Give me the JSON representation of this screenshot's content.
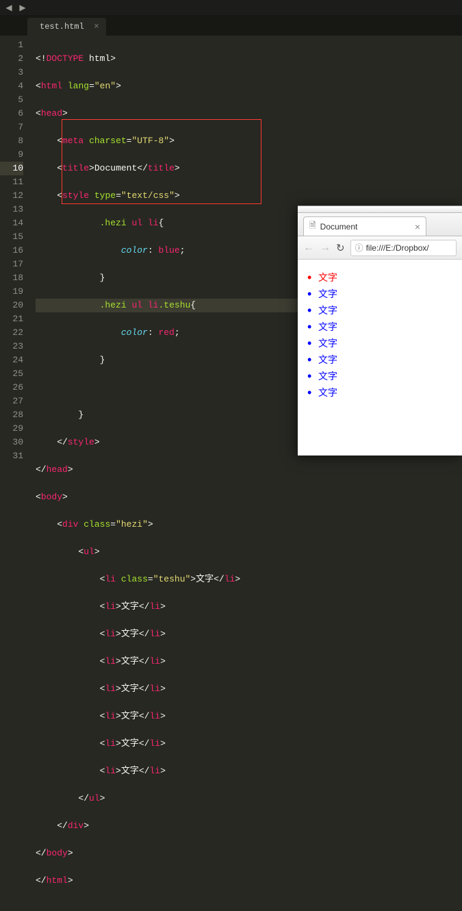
{
  "editor": {
    "tab_name": "test.html",
    "line_count": 31,
    "current_line": 10,
    "code": {
      "l1_doctype": "DOCTYPE",
      "l1_html": "html",
      "l2_tag": "html",
      "l2_attr": "lang",
      "l2_val": "\"en\"",
      "l3_tag": "head",
      "l4_tag": "meta",
      "l4_attr": "charset",
      "l4_val": "\"UTF-8\"",
      "l5_tag": "title",
      "l5_txt": "Document",
      "l6_tag": "style",
      "l6_attr": "type",
      "l6_val": "\"text/css\"",
      "l7_sel": ".hezi",
      "l7_el1": "ul",
      "l7_el2": "li",
      "l8_prop": "color",
      "l8_val": "blue",
      "l10_sel": ".hezi",
      "l10_el1": "ul",
      "l10_el2": "li",
      "l10_cls": ".teshu",
      "l11_prop": "color",
      "l11_val": "red",
      "l15_tag": "style",
      "l16_tag": "head",
      "l17_tag": "body",
      "l18_tag": "div",
      "l18_attr": "class",
      "l18_val": "\"hezi\"",
      "l19_tag": "ul",
      "l20_tag": "li",
      "l20_attr": "class",
      "l20_val": "\"teshu\"",
      "l20_txt": "文字",
      "li_tag": "li",
      "li_txt": "文字",
      "l28_tag": "ul",
      "l29_tag": "div",
      "l30_tag": "body",
      "l31_tag": "html"
    }
  },
  "browser": {
    "tab_title": "Document",
    "url": "file:///E:/Dropbox/",
    "items": [
      "文字",
      "文字",
      "文字",
      "文字",
      "文字",
      "文字",
      "文字",
      "文字"
    ]
  }
}
